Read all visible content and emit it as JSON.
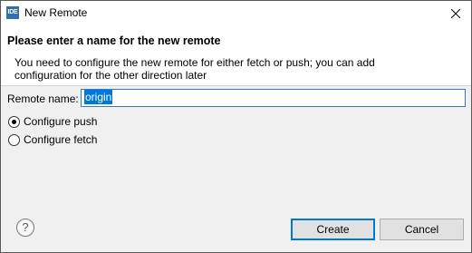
{
  "window": {
    "title": "New Remote",
    "app_icon_text": "IDE"
  },
  "banner": {
    "title": "Please enter a name for the new remote",
    "message": "You need to configure the new remote for either fetch or push; you can add configuration for the other direction later"
  },
  "form": {
    "remote_name_label": "Remote name:",
    "remote_name_value": "origin"
  },
  "options": {
    "push_label": "Configure push",
    "fetch_label": "Configure fetch",
    "selected": "push"
  },
  "buttons": {
    "create": "Create",
    "cancel": "Cancel"
  },
  "help": {
    "glyph": "?"
  }
}
